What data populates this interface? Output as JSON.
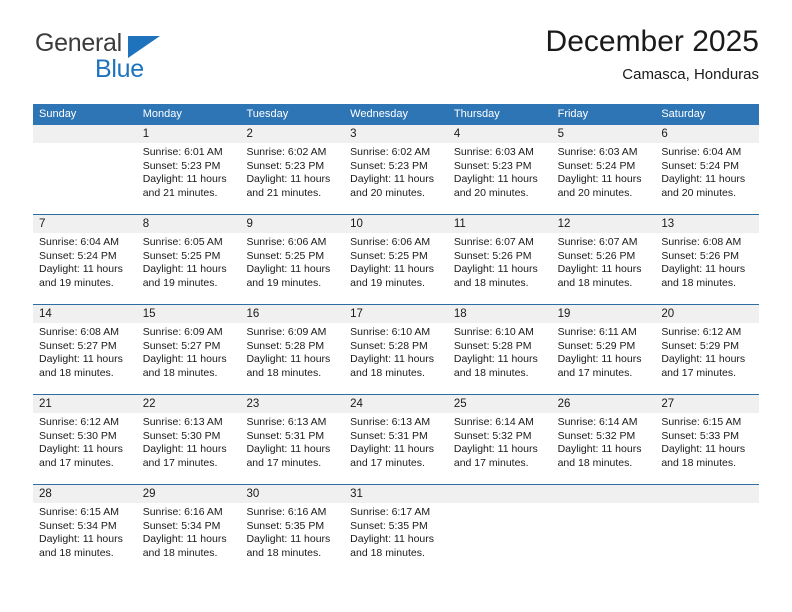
{
  "brand": {
    "name_top": "General",
    "name_bottom": "Blue",
    "flag_icon": "triangle-flag-icon",
    "accent_color": "#1f73bd"
  },
  "header": {
    "title": "December 2025",
    "subtitle": "Camasca, Honduras"
  },
  "calendar": {
    "header_color": "#2e75b6",
    "daynumber_band_color": "#f0f0f0",
    "weekdays": [
      "Sunday",
      "Monday",
      "Tuesday",
      "Wednesday",
      "Thursday",
      "Friday",
      "Saturday"
    ],
    "weeks": [
      [
        {
          "day": "",
          "sunrise": "",
          "sunset": "",
          "daylight_line1": "",
          "daylight_line2": ""
        },
        {
          "day": "1",
          "sunrise": "Sunrise: 6:01 AM",
          "sunset": "Sunset: 5:23 PM",
          "daylight_line1": "Daylight: 11 hours",
          "daylight_line2": "and 21 minutes."
        },
        {
          "day": "2",
          "sunrise": "Sunrise: 6:02 AM",
          "sunset": "Sunset: 5:23 PM",
          "daylight_line1": "Daylight: 11 hours",
          "daylight_line2": "and 21 minutes."
        },
        {
          "day": "3",
          "sunrise": "Sunrise: 6:02 AM",
          "sunset": "Sunset: 5:23 PM",
          "daylight_line1": "Daylight: 11 hours",
          "daylight_line2": "and 20 minutes."
        },
        {
          "day": "4",
          "sunrise": "Sunrise: 6:03 AM",
          "sunset": "Sunset: 5:23 PM",
          "daylight_line1": "Daylight: 11 hours",
          "daylight_line2": "and 20 minutes."
        },
        {
          "day": "5",
          "sunrise": "Sunrise: 6:03 AM",
          "sunset": "Sunset: 5:24 PM",
          "daylight_line1": "Daylight: 11 hours",
          "daylight_line2": "and 20 minutes."
        },
        {
          "day": "6",
          "sunrise": "Sunrise: 6:04 AM",
          "sunset": "Sunset: 5:24 PM",
          "daylight_line1": "Daylight: 11 hours",
          "daylight_line2": "and 20 minutes."
        }
      ],
      [
        {
          "day": "7",
          "sunrise": "Sunrise: 6:04 AM",
          "sunset": "Sunset: 5:24 PM",
          "daylight_line1": "Daylight: 11 hours",
          "daylight_line2": "and 19 minutes."
        },
        {
          "day": "8",
          "sunrise": "Sunrise: 6:05 AM",
          "sunset": "Sunset: 5:25 PM",
          "daylight_line1": "Daylight: 11 hours",
          "daylight_line2": "and 19 minutes."
        },
        {
          "day": "9",
          "sunrise": "Sunrise: 6:06 AM",
          "sunset": "Sunset: 5:25 PM",
          "daylight_line1": "Daylight: 11 hours",
          "daylight_line2": "and 19 minutes."
        },
        {
          "day": "10",
          "sunrise": "Sunrise: 6:06 AM",
          "sunset": "Sunset: 5:25 PM",
          "daylight_line1": "Daylight: 11 hours",
          "daylight_line2": "and 19 minutes."
        },
        {
          "day": "11",
          "sunrise": "Sunrise: 6:07 AM",
          "sunset": "Sunset: 5:26 PM",
          "daylight_line1": "Daylight: 11 hours",
          "daylight_line2": "and 18 minutes."
        },
        {
          "day": "12",
          "sunrise": "Sunrise: 6:07 AM",
          "sunset": "Sunset: 5:26 PM",
          "daylight_line1": "Daylight: 11 hours",
          "daylight_line2": "and 18 minutes."
        },
        {
          "day": "13",
          "sunrise": "Sunrise: 6:08 AM",
          "sunset": "Sunset: 5:26 PM",
          "daylight_line1": "Daylight: 11 hours",
          "daylight_line2": "and 18 minutes."
        }
      ],
      [
        {
          "day": "14",
          "sunrise": "Sunrise: 6:08 AM",
          "sunset": "Sunset: 5:27 PM",
          "daylight_line1": "Daylight: 11 hours",
          "daylight_line2": "and 18 minutes."
        },
        {
          "day": "15",
          "sunrise": "Sunrise: 6:09 AM",
          "sunset": "Sunset: 5:27 PM",
          "daylight_line1": "Daylight: 11 hours",
          "daylight_line2": "and 18 minutes."
        },
        {
          "day": "16",
          "sunrise": "Sunrise: 6:09 AM",
          "sunset": "Sunset: 5:28 PM",
          "daylight_line1": "Daylight: 11 hours",
          "daylight_line2": "and 18 minutes."
        },
        {
          "day": "17",
          "sunrise": "Sunrise: 6:10 AM",
          "sunset": "Sunset: 5:28 PM",
          "daylight_line1": "Daylight: 11 hours",
          "daylight_line2": "and 18 minutes."
        },
        {
          "day": "18",
          "sunrise": "Sunrise: 6:10 AM",
          "sunset": "Sunset: 5:28 PM",
          "daylight_line1": "Daylight: 11 hours",
          "daylight_line2": "and 18 minutes."
        },
        {
          "day": "19",
          "sunrise": "Sunrise: 6:11 AM",
          "sunset": "Sunset: 5:29 PM",
          "daylight_line1": "Daylight: 11 hours",
          "daylight_line2": "and 17 minutes."
        },
        {
          "day": "20",
          "sunrise": "Sunrise: 6:12 AM",
          "sunset": "Sunset: 5:29 PM",
          "daylight_line1": "Daylight: 11 hours",
          "daylight_line2": "and 17 minutes."
        }
      ],
      [
        {
          "day": "21",
          "sunrise": "Sunrise: 6:12 AM",
          "sunset": "Sunset: 5:30 PM",
          "daylight_line1": "Daylight: 11 hours",
          "daylight_line2": "and 17 minutes."
        },
        {
          "day": "22",
          "sunrise": "Sunrise: 6:13 AM",
          "sunset": "Sunset: 5:30 PM",
          "daylight_line1": "Daylight: 11 hours",
          "daylight_line2": "and 17 minutes."
        },
        {
          "day": "23",
          "sunrise": "Sunrise: 6:13 AM",
          "sunset": "Sunset: 5:31 PM",
          "daylight_line1": "Daylight: 11 hours",
          "daylight_line2": "and 17 minutes."
        },
        {
          "day": "24",
          "sunrise": "Sunrise: 6:13 AM",
          "sunset": "Sunset: 5:31 PM",
          "daylight_line1": "Daylight: 11 hours",
          "daylight_line2": "and 17 minutes."
        },
        {
          "day": "25",
          "sunrise": "Sunrise: 6:14 AM",
          "sunset": "Sunset: 5:32 PM",
          "daylight_line1": "Daylight: 11 hours",
          "daylight_line2": "and 17 minutes."
        },
        {
          "day": "26",
          "sunrise": "Sunrise: 6:14 AM",
          "sunset": "Sunset: 5:32 PM",
          "daylight_line1": "Daylight: 11 hours",
          "daylight_line2": "and 18 minutes."
        },
        {
          "day": "27",
          "sunrise": "Sunrise: 6:15 AM",
          "sunset": "Sunset: 5:33 PM",
          "daylight_line1": "Daylight: 11 hours",
          "daylight_line2": "and 18 minutes."
        }
      ],
      [
        {
          "day": "28",
          "sunrise": "Sunrise: 6:15 AM",
          "sunset": "Sunset: 5:34 PM",
          "daylight_line1": "Daylight: 11 hours",
          "daylight_line2": "and 18 minutes."
        },
        {
          "day": "29",
          "sunrise": "Sunrise: 6:16 AM",
          "sunset": "Sunset: 5:34 PM",
          "daylight_line1": "Daylight: 11 hours",
          "daylight_line2": "and 18 minutes."
        },
        {
          "day": "30",
          "sunrise": "Sunrise: 6:16 AM",
          "sunset": "Sunset: 5:35 PM",
          "daylight_line1": "Daylight: 11 hours",
          "daylight_line2": "and 18 minutes."
        },
        {
          "day": "31",
          "sunrise": "Sunrise: 6:17 AM",
          "sunset": "Sunset: 5:35 PM",
          "daylight_line1": "Daylight: 11 hours",
          "daylight_line2": "and 18 minutes."
        },
        {
          "day": "",
          "sunrise": "",
          "sunset": "",
          "daylight_line1": "",
          "daylight_line2": ""
        },
        {
          "day": "",
          "sunrise": "",
          "sunset": "",
          "daylight_line1": "",
          "daylight_line2": ""
        },
        {
          "day": "",
          "sunrise": "",
          "sunset": "",
          "daylight_line1": "",
          "daylight_line2": ""
        }
      ]
    ]
  }
}
